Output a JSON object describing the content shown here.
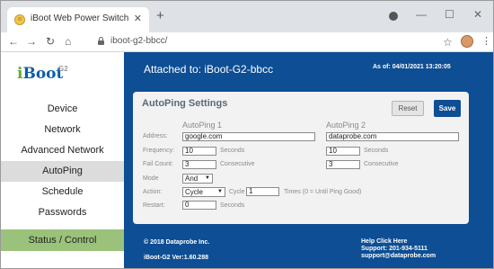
{
  "browser": {
    "tab_title": "iBoot Web Power Switch",
    "tab_close": "✕",
    "new_tab": "+",
    "url": "iboot-g2-bbcc/",
    "min": "—",
    "max": "☐",
    "close": "✕",
    "back": "←",
    "forward": "→",
    "reload": "↻",
    "home": "⌂",
    "star": "☆",
    "menu": "⋮"
  },
  "logo": {
    "mark_i": "i",
    "mark_rest": "Boot",
    "sup": "G2"
  },
  "sidebar": {
    "items": [
      {
        "label": "Device"
      },
      {
        "label": "Network"
      },
      {
        "label": "Advanced Network"
      },
      {
        "label": "AutoPing"
      },
      {
        "label": "Schedule"
      },
      {
        "label": "Passwords"
      }
    ],
    "active_index": 3,
    "status_control": "Status / Control"
  },
  "header": {
    "attached": "Attached to: iBoot-G2-bbcc",
    "as_of": "As of: 04/01/2021 13:20:05"
  },
  "autoping": {
    "title": "AutoPing Settings",
    "reset_label": "Reset",
    "save_label": "Save",
    "col1": "AutoPing 1",
    "col2": "AutoPing 2",
    "labels": {
      "address": "Address:",
      "frequency": "Frequency:",
      "fail_count": "Fail Count:",
      "mode": "Mode",
      "action": "Action:",
      "restart": "Restart:"
    },
    "ping1": {
      "address": "google.com",
      "frequency": "10",
      "fail_count": "3"
    },
    "ping2": {
      "address": "dataprobe.com",
      "frequency": "10",
      "fail_count": "3"
    },
    "seconds": "Seconds",
    "consecutive": "Consecutive",
    "mode_value": "And",
    "action_value": "Cycle",
    "cycle_label": "Cycle",
    "cycle_value": "1",
    "times_note": "Times (0 = Until Ping Good)",
    "restart_value": "0",
    "restart_unit": "Seconds"
  },
  "footer": {
    "copyright": "© 2018 Dataprobe Inc.",
    "version": "iBoot-G2 Ver:1.60.288",
    "help": "Help Click Here",
    "support_phone": "Support: 201-934-5111",
    "support_email": "support@dataprobe.com"
  },
  "colors": {
    "brand_blue": "#0d4e94",
    "status_green": "#9ac27a"
  }
}
